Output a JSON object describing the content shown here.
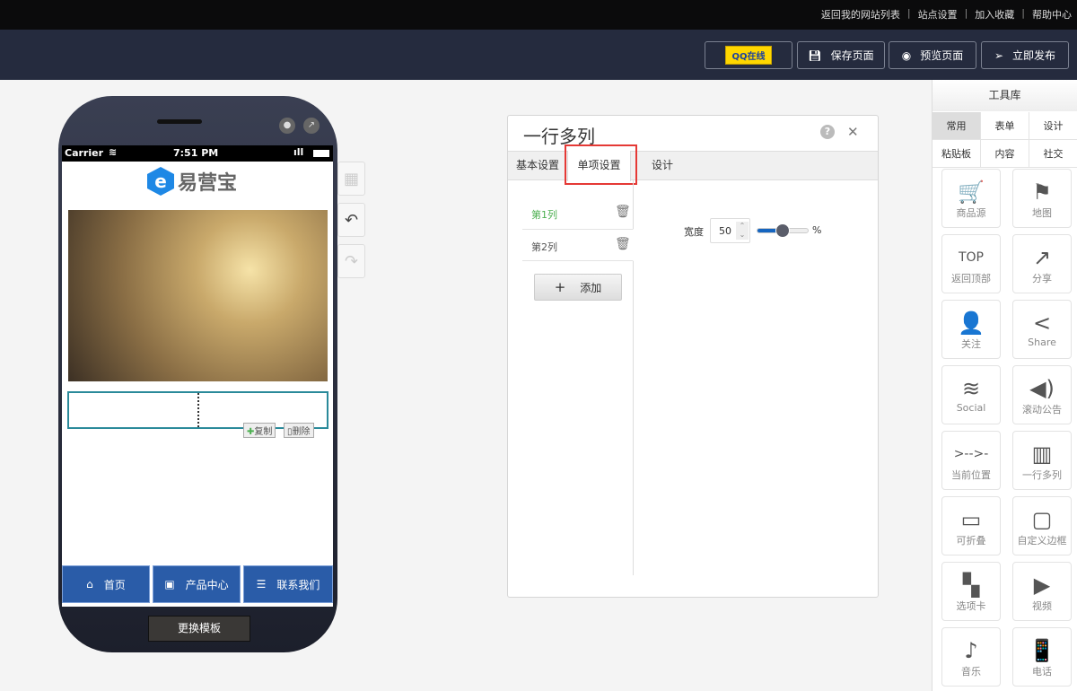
{
  "topbar": {
    "links": [
      "返回我的网站列表",
      "站点设置",
      "加入收藏",
      "帮助中心"
    ]
  },
  "toolbar": {
    "qq": "QQ在线",
    "save": "保存页面",
    "preview": "预览页面",
    "publish": "立即发布"
  },
  "phone": {
    "carrier": "Carrier",
    "time": "7:51 PM",
    "logo": "易营宝",
    "copy": "复制",
    "delete": "删除",
    "nav": [
      {
        "label": "首页",
        "icon": "⌂"
      },
      {
        "label": "产品中心",
        "icon": "▣"
      },
      {
        "label": "联系我们",
        "icon": "☰"
      }
    ],
    "change_template": "更换模板"
  },
  "dialog": {
    "title": "一行多列",
    "tabs": [
      "基本设置",
      "单项设置",
      "设计"
    ],
    "active_tab": 1,
    "columns": [
      "第1列",
      "第2列"
    ],
    "add": "添加",
    "width_label": "宽度",
    "width_value": "50",
    "unit": "%",
    "slider_percent": 50
  },
  "tools": {
    "title": "工具库",
    "categories": [
      "常用",
      "表单",
      "设计",
      "粘贴板",
      "内容",
      "社交"
    ],
    "items": [
      {
        "label": "商品源",
        "icon": "🛒"
      },
      {
        "label": "地图",
        "icon": "⚑"
      },
      {
        "label": "返回顶部",
        "icon": "TOP"
      },
      {
        "label": "分享",
        "icon": "↗"
      },
      {
        "label": "关注",
        "icon": "👤"
      },
      {
        "label": "Share",
        "icon": "<"
      },
      {
        "label": "Social",
        "icon": "≋"
      },
      {
        "label": "滚动公告",
        "icon": "◀)"
      },
      {
        "label": "当前位置",
        "icon": ">-->-"
      },
      {
        "label": "一行多列",
        "icon": "▥"
      },
      {
        "label": "可折叠",
        "icon": "▭"
      },
      {
        "label": "自定义边框",
        "icon": "▢"
      },
      {
        "label": "选项卡",
        "icon": "▚"
      },
      {
        "label": "视频",
        "icon": "▶"
      },
      {
        "label": "音乐",
        "icon": "♪"
      },
      {
        "label": "电话",
        "icon": "📱"
      }
    ]
  },
  "colors": {
    "accent": "#2a5ca8",
    "active": "#4caf50",
    "highlight": "#e53935"
  }
}
